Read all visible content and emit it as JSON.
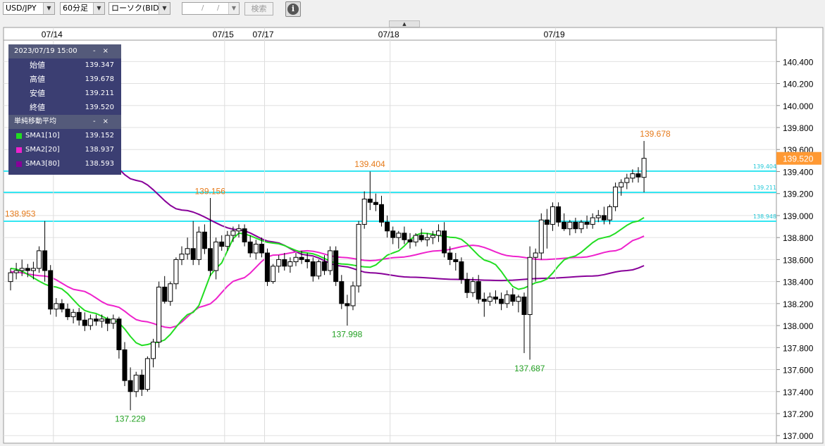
{
  "toolbar": {
    "pair": "USD/JPY",
    "interval": "60分足",
    "chart_kind": "ローソク(BID)",
    "date_sep1": "/",
    "date_sep2": "/",
    "search_label": "検索",
    "info_symbol": "i"
  },
  "dropdown_arrow": "▼",
  "collapse_handle": "▲",
  "tooltip": {
    "timestamp": "2023/07/19 15:00",
    "rows": [
      {
        "label": "始値",
        "value": "139.347"
      },
      {
        "label": "高値",
        "value": "139.678"
      },
      {
        "label": "安値",
        "value": "139.211"
      },
      {
        "label": "終値",
        "value": "139.520"
      }
    ],
    "controls": "-×",
    "sma_title": "単純移動平均",
    "sma_rows": [
      {
        "label": "SMA1[10]",
        "value": "139.152",
        "color": "#22dd22"
      },
      {
        "label": "SMA2[20]",
        "value": "138.937",
        "color": "#ee22cc"
      },
      {
        "label": "SMA3[80]",
        "value": "138.593",
        "color": "#880099"
      }
    ]
  },
  "colors": {
    "up": "#ffffff",
    "down": "#000000",
    "wick": "#000000",
    "hline": "#33e6f2",
    "current_price_bg": "#ff9933",
    "annotation_high": "#e67a1a",
    "annotation_low": "#22a022",
    "grid": "#e0e0e0"
  },
  "chart_data": {
    "type": "candlestick",
    "symbol": "USD/JPY",
    "timeframe": "60分足",
    "ylim": [
      137.0,
      140.5
    ],
    "yticks": [
      "140.400",
      "140.200",
      "140.000",
      "139.800",
      "139.600",
      "139.400",
      "139.200",
      "139.000",
      "138.800",
      "138.600",
      "138.400",
      "138.200",
      "138.000",
      "137.800",
      "137.600",
      "137.400",
      "137.200",
      "137.000"
    ],
    "date_labels": [
      "07/14",
      "07/15",
      "07/17",
      "07/18",
      "07/19"
    ],
    "date_label_bar_index": [
      8,
      38,
      45,
      67,
      96
    ],
    "current_price": "139.520",
    "horizontal_lines": [
      {
        "value": 139.404,
        "label": "139.404"
      },
      {
        "value": 139.211,
        "label": "139.211"
      },
      {
        "value": 138.948,
        "label": "138.948"
      }
    ],
    "annotations": [
      {
        "text": "138.953",
        "kind": "high",
        "bar": 0,
        "value": 138.953
      },
      {
        "text": "137.229",
        "kind": "low",
        "bar": 21,
        "value": 137.229
      },
      {
        "text": "139.156",
        "kind": "high",
        "bar": 35,
        "value": 139.156
      },
      {
        "text": "137.998",
        "kind": "low",
        "bar": 59,
        "value": 137.998
      },
      {
        "text": "139.404",
        "kind": "high",
        "bar": 63,
        "value": 139.404
      },
      {
        "text": "137.687",
        "kind": "low",
        "bar": 91,
        "value": 137.687
      },
      {
        "text": "139.678",
        "kind": "high",
        "bar": 113,
        "value": 139.678
      }
    ],
    "candles": [
      [
        138.4,
        138.52,
        138.32,
        138.48
      ],
      [
        138.48,
        138.57,
        138.42,
        138.5
      ],
      [
        138.5,
        138.6,
        138.45,
        138.52
      ],
      [
        138.52,
        138.56,
        138.44,
        138.5
      ],
      [
        138.5,
        138.58,
        138.42,
        138.52
      ],
      [
        138.52,
        138.72,
        138.48,
        138.68
      ],
      [
        138.68,
        138.95,
        138.4,
        138.5
      ],
      [
        138.5,
        138.55,
        138.1,
        138.15
      ],
      [
        138.15,
        138.25,
        138.08,
        138.2
      ],
      [
        138.2,
        138.24,
        138.12,
        138.15
      ],
      [
        138.15,
        138.2,
        138.05,
        138.08
      ],
      [
        138.08,
        138.15,
        138.02,
        138.12
      ],
      [
        138.12,
        138.16,
        138.0,
        138.05
      ],
      [
        138.05,
        138.12,
        137.95,
        138.0
      ],
      [
        138.0,
        138.1,
        137.96,
        138.06
      ],
      [
        138.06,
        138.1,
        138.0,
        138.04
      ],
      [
        138.04,
        138.1,
        137.98,
        138.06
      ],
      [
        138.06,
        138.08,
        137.95,
        138.02
      ],
      [
        138.02,
        138.1,
        137.97,
        138.06
      ],
      [
        138.06,
        138.08,
        137.7,
        137.78
      ],
      [
        137.78,
        137.85,
        137.45,
        137.5
      ],
      [
        137.5,
        137.62,
        137.23,
        137.4
      ],
      [
        137.4,
        137.58,
        137.35,
        137.55
      ],
      [
        137.55,
        137.6,
        137.36,
        137.42
      ],
      [
        137.42,
        137.72,
        137.4,
        137.7
      ],
      [
        137.7,
        137.88,
        137.62,
        137.85
      ],
      [
        137.85,
        138.4,
        137.8,
        138.35
      ],
      [
        138.35,
        138.45,
        138.2,
        138.22
      ],
      [
        138.22,
        138.4,
        138.18,
        138.38
      ],
      [
        138.38,
        138.62,
        138.33,
        138.6
      ],
      [
        138.6,
        138.72,
        138.55,
        138.65
      ],
      [
        138.65,
        138.8,
        138.6,
        138.7
      ],
      [
        138.7,
        138.95,
        138.55,
        138.6
      ],
      [
        138.6,
        138.9,
        138.55,
        138.85
      ],
      [
        138.85,
        138.92,
        138.65,
        138.7
      ],
      [
        138.7,
        139.16,
        138.45,
        138.5
      ],
      [
        138.5,
        138.8,
        138.42,
        138.76
      ],
      [
        138.76,
        138.82,
        138.68,
        138.72
      ],
      [
        138.72,
        138.86,
        138.68,
        138.82
      ],
      [
        138.82,
        138.9,
        138.76,
        138.86
      ],
      [
        138.86,
        138.92,
        138.8,
        138.88
      ],
      [
        138.88,
        138.92,
        138.72,
        138.76
      ],
      [
        138.76,
        138.82,
        138.62,
        138.66
      ],
      [
        138.66,
        138.78,
        138.6,
        138.74
      ],
      [
        138.74,
        138.8,
        138.62,
        138.66
      ],
      [
        138.66,
        138.7,
        138.36,
        138.4
      ],
      [
        138.4,
        138.56,
        138.38,
        138.54
      ],
      [
        138.54,
        138.64,
        138.48,
        138.6
      ],
      [
        138.6,
        138.66,
        138.5,
        138.54
      ],
      [
        138.54,
        138.62,
        138.48,
        138.58
      ],
      [
        138.58,
        138.66,
        138.54,
        138.62
      ],
      [
        138.62,
        138.68,
        138.56,
        138.6
      ],
      [
        138.6,
        138.66,
        138.52,
        138.58
      ],
      [
        138.58,
        138.62,
        138.4,
        138.45
      ],
      [
        138.45,
        138.6,
        138.42,
        138.58
      ],
      [
        138.58,
        138.64,
        138.46,
        138.5
      ],
      [
        138.5,
        138.72,
        138.46,
        138.68
      ],
      [
        138.68,
        138.72,
        138.36,
        138.4
      ],
      [
        138.4,
        138.46,
        138.15,
        138.2
      ],
      [
        138.2,
        138.28,
        138.0,
        138.18
      ],
      [
        138.18,
        138.4,
        138.14,
        138.36
      ],
      [
        138.36,
        138.95,
        138.3,
        138.92
      ],
      [
        138.92,
        139.22,
        138.88,
        139.15
      ],
      [
        139.15,
        139.4,
        139.05,
        139.12
      ],
      [
        139.12,
        139.2,
        139.04,
        139.1
      ],
      [
        139.1,
        139.18,
        138.9,
        138.94
      ],
      [
        138.94,
        139.0,
        138.8,
        138.86
      ],
      [
        138.86,
        138.9,
        138.74,
        138.8
      ],
      [
        138.8,
        138.86,
        138.7,
        138.84
      ],
      [
        138.84,
        138.9,
        138.74,
        138.78
      ],
      [
        138.78,
        138.84,
        138.7,
        138.76
      ],
      [
        138.76,
        138.84,
        138.72,
        138.82
      ],
      [
        138.82,
        138.88,
        138.76,
        138.78
      ],
      [
        138.78,
        138.84,
        138.72,
        138.8
      ],
      [
        138.8,
        138.86,
        138.74,
        138.82
      ],
      [
        138.82,
        138.92,
        138.76,
        138.86
      ],
      [
        138.86,
        138.94,
        138.62,
        138.66
      ],
      [
        138.66,
        138.72,
        138.55,
        138.6
      ],
      [
        138.6,
        138.66,
        138.5,
        138.58
      ],
      [
        138.58,
        138.62,
        138.38,
        138.42
      ],
      [
        138.42,
        138.48,
        138.25,
        138.3
      ],
      [
        138.3,
        138.44,
        138.26,
        138.4
      ],
      [
        138.4,
        138.46,
        138.2,
        138.24
      ],
      [
        138.24,
        138.3,
        138.08,
        138.22
      ],
      [
        138.22,
        138.3,
        138.18,
        138.26
      ],
      [
        138.26,
        138.32,
        138.2,
        138.24
      ],
      [
        138.24,
        138.3,
        138.14,
        138.2
      ],
      [
        138.2,
        138.32,
        138.16,
        138.28
      ],
      [
        138.28,
        138.34,
        138.18,
        138.22
      ],
      [
        138.22,
        138.28,
        138.12,
        138.26
      ],
      [
        138.26,
        138.3,
        137.75,
        138.1
      ],
      [
        138.1,
        138.72,
        137.69,
        138.62
      ],
      [
        138.62,
        138.7,
        138.4,
        138.66
      ],
      [
        138.66,
        139.02,
        138.6,
        138.96
      ],
      [
        138.96,
        139.06,
        138.7,
        138.92
      ],
      [
        138.92,
        139.12,
        138.86,
        139.08
      ],
      [
        139.08,
        139.12,
        138.9,
        138.94
      ],
      [
        138.94,
        139.02,
        138.86,
        138.88
      ],
      [
        138.88,
        138.96,
        138.82,
        138.94
      ],
      [
        138.94,
        138.98,
        138.84,
        138.88
      ],
      [
        138.88,
        138.96,
        138.84,
        138.94
      ],
      [
        138.94,
        139.0,
        138.88,
        138.92
      ],
      [
        138.92,
        139.02,
        138.88,
        138.98
      ],
      [
        138.98,
        139.05,
        138.94,
        139.0
      ],
      [
        139.0,
        139.08,
        138.92,
        138.96
      ],
      [
        138.96,
        139.1,
        138.92,
        139.08
      ],
      [
        139.08,
        139.3,
        139.04,
        139.26
      ],
      [
        139.26,
        139.33,
        139.18,
        139.3
      ],
      [
        139.3,
        139.38,
        139.24,
        139.34
      ],
      [
        139.34,
        139.42,
        139.3,
        139.38
      ],
      [
        139.38,
        139.44,
        139.3,
        139.35
      ],
      [
        139.347,
        139.678,
        139.211,
        139.52
      ]
    ],
    "sma": [
      {
        "name": "SMA1[10]",
        "color": "#22dd22",
        "anchors": [
          [
            0,
            138.52
          ],
          [
            8,
            138.35
          ],
          [
            14,
            138.12
          ],
          [
            18,
            138.05
          ],
          [
            23,
            137.82
          ],
          [
            26,
            137.85
          ],
          [
            32,
            138.12
          ],
          [
            36,
            138.52
          ],
          [
            40,
            138.84
          ],
          [
            46,
            138.75
          ],
          [
            52,
            138.66
          ],
          [
            58,
            138.56
          ],
          [
            63,
            138.53
          ],
          [
            67,
            138.66
          ],
          [
            72,
            138.84
          ],
          [
            78,
            138.8
          ],
          [
            84,
            138.58
          ],
          [
            89,
            138.33
          ],
          [
            93,
            138.4
          ],
          [
            98,
            138.62
          ],
          [
            104,
            138.8
          ],
          [
            110,
            138.95
          ],
          [
            114,
            139.15
          ]
        ]
      },
      {
        "name": "SMA2[20]",
        "color": "#ee22cc",
        "anchors": [
          [
            0,
            138.49
          ],
          [
            6,
            138.45
          ],
          [
            12,
            138.32
          ],
          [
            18,
            138.18
          ],
          [
            23,
            138.04
          ],
          [
            28,
            137.98
          ],
          [
            34,
            138.18
          ],
          [
            40,
            138.42
          ],
          [
            46,
            138.64
          ],
          [
            52,
            138.68
          ],
          [
            58,
            138.62
          ],
          [
            63,
            138.59
          ],
          [
            68,
            138.62
          ],
          [
            75,
            138.68
          ],
          [
            81,
            138.73
          ],
          [
            88,
            138.63
          ],
          [
            93,
            138.6
          ],
          [
            100,
            138.62
          ],
          [
            106,
            138.68
          ],
          [
            110,
            138.79
          ],
          [
            114,
            138.94
          ]
        ]
      },
      {
        "name": "SMA3[80]",
        "color": "#880099",
        "anchors": [
          [
            0,
            140.27
          ],
          [
            8,
            140.05
          ],
          [
            14,
            139.65
          ],
          [
            22,
            139.32
          ],
          [
            30,
            139.05
          ],
          [
            40,
            138.87
          ],
          [
            46,
            138.76
          ],
          [
            52,
            138.64
          ],
          [
            58,
            138.54
          ],
          [
            63,
            138.48
          ],
          [
            70,
            138.44
          ],
          [
            78,
            138.42
          ],
          [
            86,
            138.41
          ],
          [
            94,
            138.43
          ],
          [
            102,
            138.45
          ],
          [
            108,
            138.5
          ],
          [
            114,
            138.59
          ]
        ]
      }
    ]
  }
}
